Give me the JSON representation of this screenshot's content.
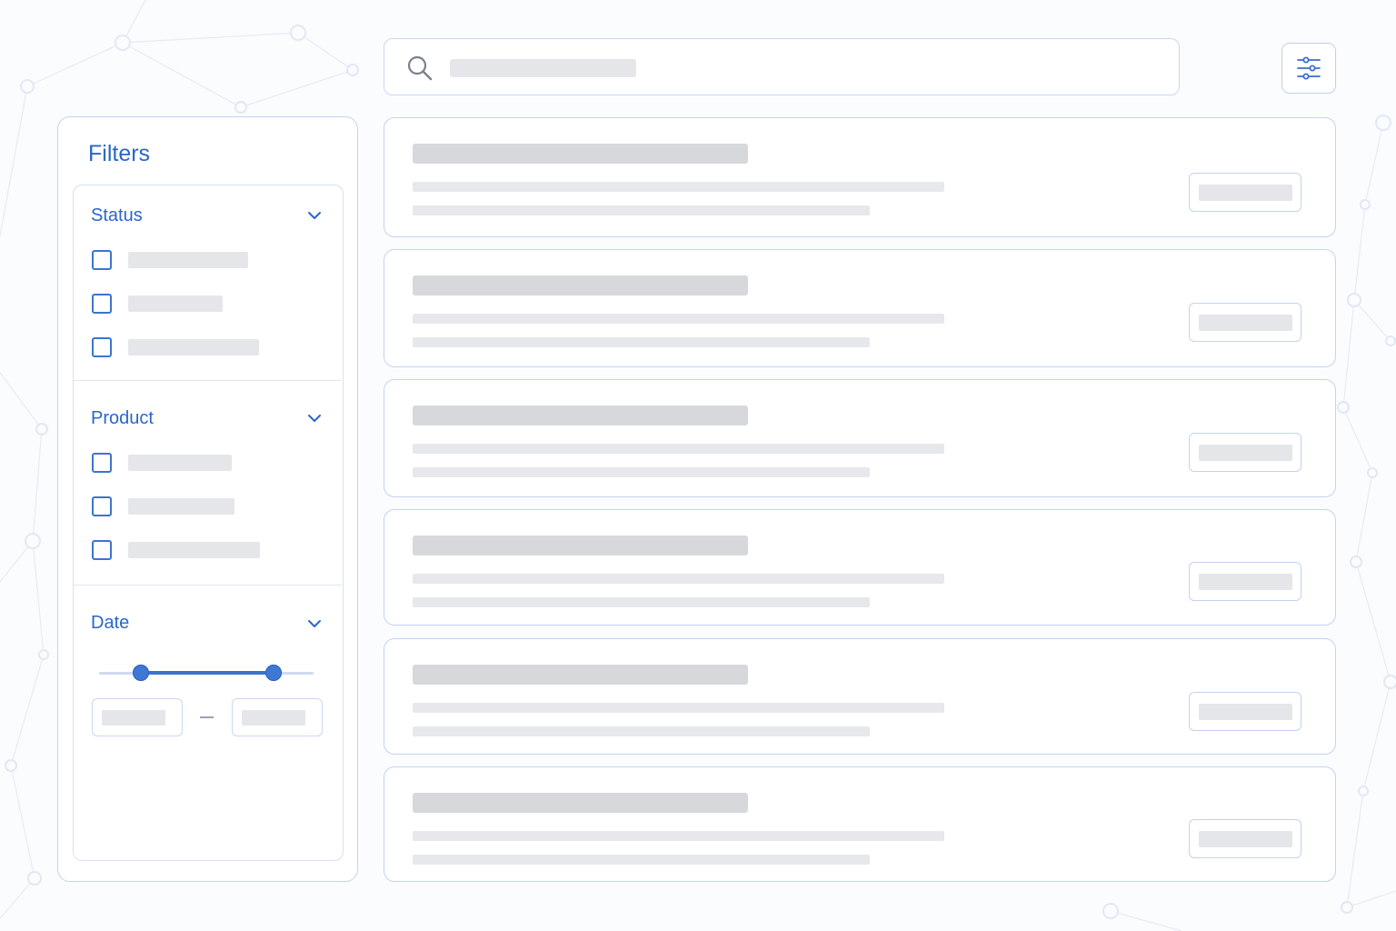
{
  "colors": {
    "accent": "#2a66c9",
    "border": "#c3d3ee",
    "placeholder": "#e4e6ea",
    "background": "#fbfcfe"
  },
  "search": {
    "icon": "search-icon",
    "placeholder": ""
  },
  "toolbar": {
    "filter_toggle_icon": "sliders-icon"
  },
  "filters": {
    "title": "Filters",
    "sections": {
      "status": {
        "label": "Status",
        "icon": "chevron-down-icon",
        "option_count": 3
      },
      "product": {
        "label": "Product",
        "icon": "chevron-down-icon",
        "option_count": 3
      },
      "date": {
        "label": "Date",
        "icon": "chevron-down-icon",
        "range_start_fraction": 0.19,
        "range_end_fraction": 0.81,
        "range_separator": "–"
      }
    }
  },
  "results": {
    "item_count": 6,
    "state": "loading-skeleton"
  }
}
